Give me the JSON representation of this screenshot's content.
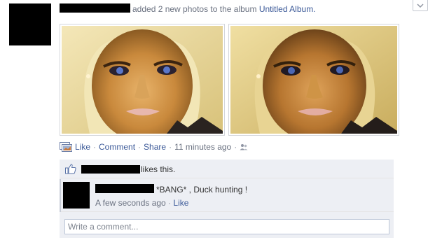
{
  "story": {
    "action_text": "added 2 new photos to the album",
    "album_link": "Untitled Album."
  },
  "actions": {
    "like": "Like",
    "comment": "Comment",
    "share": "Share",
    "timestamp": "11 minutes ago",
    "separator": "·"
  },
  "feedback": {
    "likes_text": "likes this.",
    "comment": {
      "text": "*BANG* , Duck hunting !",
      "timestamp": "A few seconds ago",
      "like": "Like",
      "separator": "·"
    },
    "write_placeholder": "Write a comment..."
  },
  "icons": {
    "story_icon": "photo-album-icon",
    "privacy_icon": "friends-icon",
    "like_icon": "thumbs-up-icon",
    "menu_icon": "chevron-down-icon"
  },
  "colors": {
    "link": "#3b5998",
    "feedback_bg": "#edeff4",
    "redaction": "#000000"
  }
}
